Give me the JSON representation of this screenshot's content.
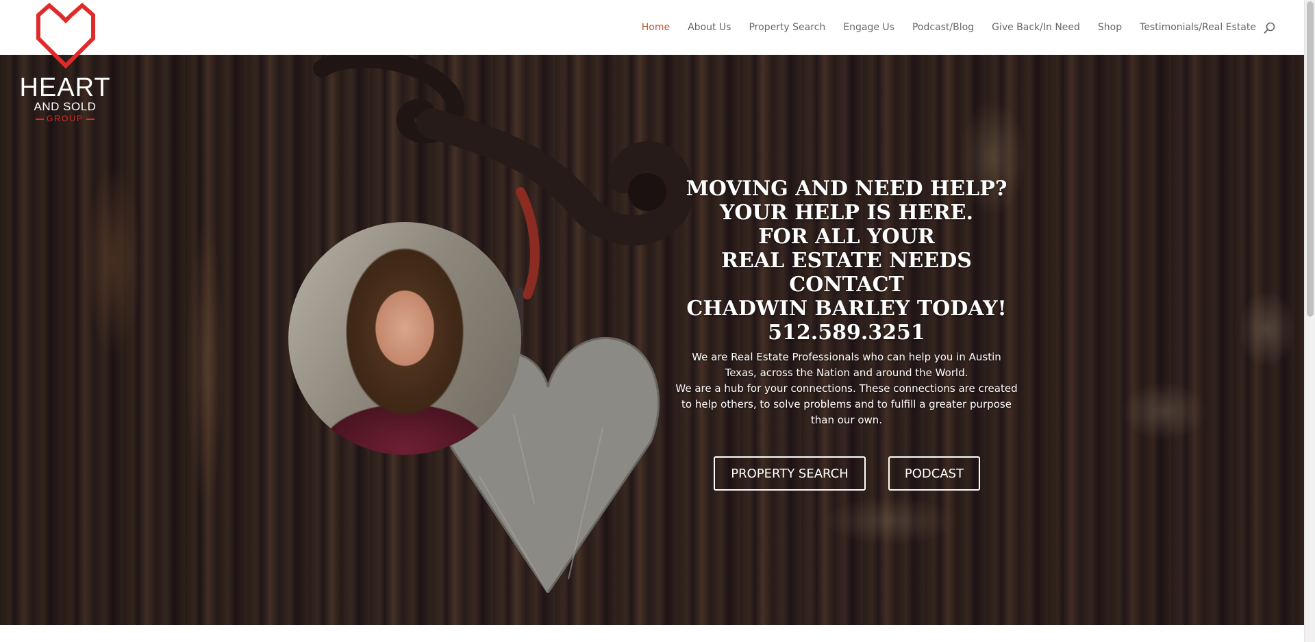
{
  "logo": {
    "line1": "HEART",
    "line2": "AND SOLD",
    "line3": "GROUP",
    "icon": "house-heart-icon",
    "accent_color": "#e12b2b"
  },
  "nav": {
    "items": [
      {
        "label": "Home",
        "active": true
      },
      {
        "label": "About Us",
        "active": false
      },
      {
        "label": "Property Search",
        "active": false
      },
      {
        "label": "Engage Us",
        "active": false
      },
      {
        "label": "Podcast/Blog",
        "active": false
      },
      {
        "label": "Give Back/In Need",
        "active": false
      },
      {
        "label": "Shop",
        "active": false
      },
      {
        "label": "Testimonials/Real Estate",
        "active": false
      }
    ],
    "active_color": "#c0562f",
    "search_icon": "search-icon"
  },
  "hero": {
    "headline": [
      "MOVING AND NEED HELP?",
      "YOUR HELP IS HERE.",
      "FOR ALL YOUR",
      "REAL ESTATE NEEDS",
      "CONTACT",
      "CHADWIN BARLEY TODAY!"
    ],
    "phone": "512.589.3251",
    "body": [
      "We are Real Estate Professionals who can help you in Austin",
      "Texas, across the Nation and around the World.",
      "We are a hub for your connections. These connections are created",
      "to help others, to solve problems and to fulfill a greater purpose",
      "than our own."
    ],
    "buttons": {
      "property_search": "PROPERTY SEARCH",
      "podcast": "PODCAST"
    }
  }
}
